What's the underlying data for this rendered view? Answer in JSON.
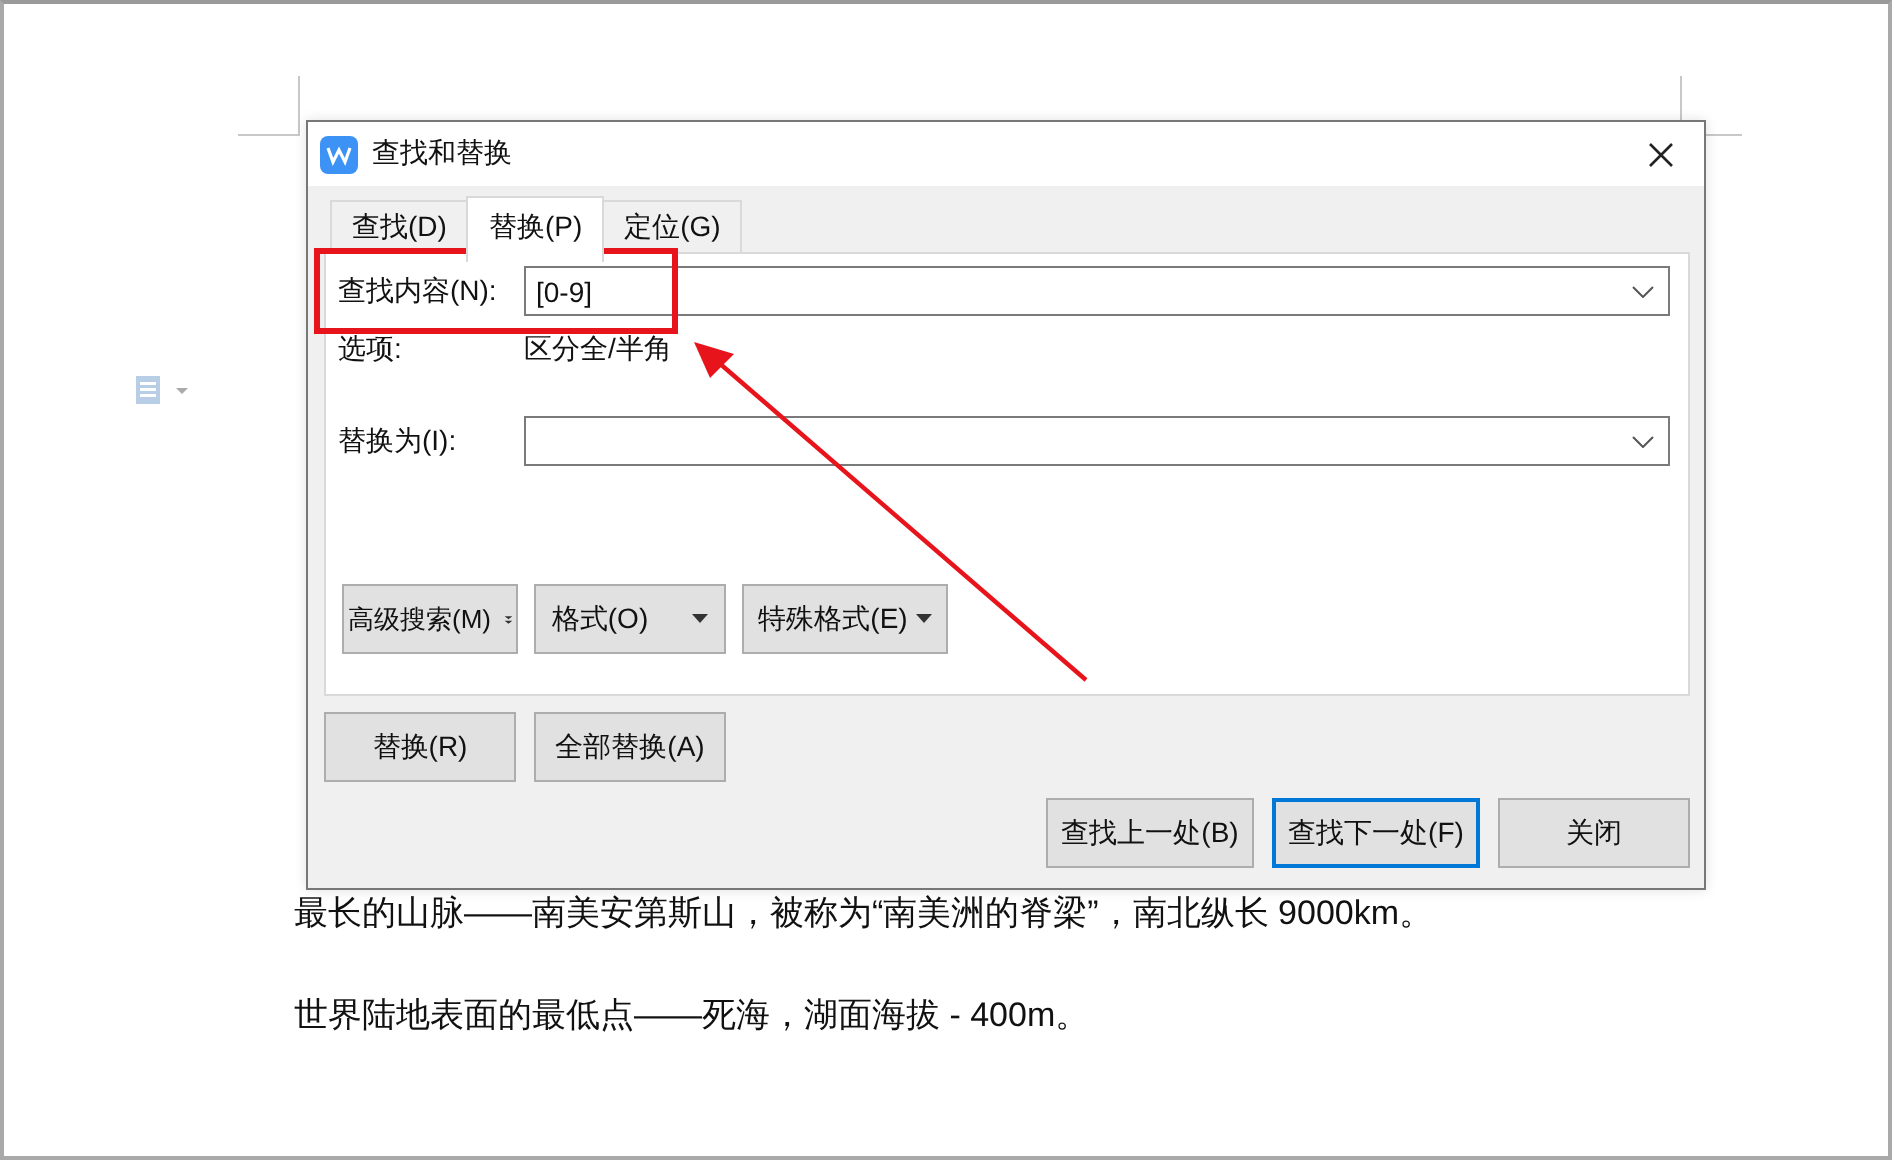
{
  "document": {
    "paragraphs": [
      "最长的山脉——南美安第斯山，被称为“南美洲的脊梁”，南北纵长 9000km。",
      "世界陆地表面的最低点——死海，湖面海拔 - 400m。"
    ]
  },
  "dialog": {
    "title": "查找和替换",
    "tabs": [
      {
        "label": "查找(D)",
        "selected": false
      },
      {
        "label": "替换(P)",
        "selected": true
      },
      {
        "label": "定位(G)",
        "selected": false
      }
    ],
    "find": {
      "label": "查找内容(N):",
      "value": "[0-9]"
    },
    "options": {
      "label": "选项:",
      "value": "区分全/半角"
    },
    "replace": {
      "label": "替换为(I):"
    },
    "option_buttons": [
      {
        "label": "高级搜索(M)",
        "kind": "expand"
      },
      {
        "label": "格式(O)",
        "kind": "dropdown"
      },
      {
        "label": "特殊格式(E)",
        "kind": "dropdown"
      }
    ],
    "replace_buttons": [
      "替换(R)",
      "全部替换(A)"
    ],
    "bottom_buttons": [
      {
        "label": "查找上一处(B)",
        "selected": false
      },
      {
        "label": "查找下一处(F)",
        "selected": true
      },
      {
        "label": "关闭",
        "selected": false
      }
    ]
  }
}
